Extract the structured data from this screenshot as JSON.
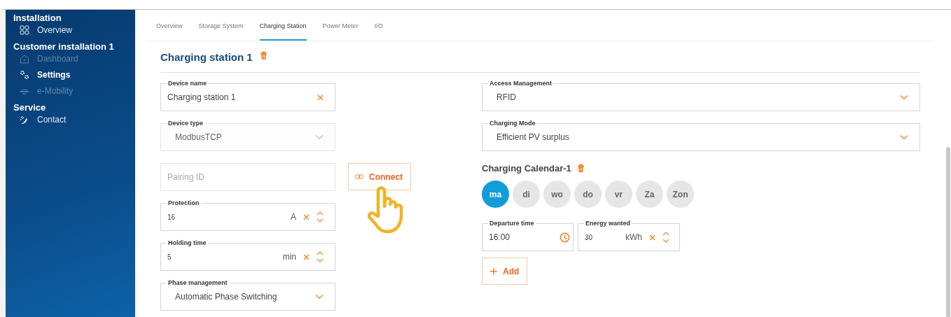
{
  "sidebar": {
    "sections": [
      {
        "title": "Installation",
        "items": [
          {
            "label": "Overview",
            "selected": false,
            "disabled": false
          }
        ]
      },
      {
        "title": "Customer installation 1",
        "items": [
          {
            "label": "Dashboard",
            "selected": false,
            "disabled": true
          },
          {
            "label": "Settings",
            "selected": true,
            "disabled": false
          },
          {
            "label": "e-Mobility",
            "selected": false,
            "disabled": true
          }
        ]
      },
      {
        "title": "Service",
        "items": [
          {
            "label": "Contact",
            "selected": false,
            "disabled": false
          }
        ]
      }
    ]
  },
  "tabs": [
    {
      "label": "Overview",
      "selected": false
    },
    {
      "label": "Storage System",
      "selected": false
    },
    {
      "label": "Charging Station",
      "selected": true
    },
    {
      "label": "Power Meter",
      "selected": false
    },
    {
      "label": "I/O",
      "selected": false
    }
  ],
  "device": {
    "title": "Charging station 1",
    "left_fields": [
      {
        "kind": "text",
        "label": "Device name",
        "value": "Charging station 1"
      },
      {
        "kind": "select",
        "label": "Device type",
        "value": "ModbusTCP",
        "disabled": true
      },
      {
        "kind": "placeholder",
        "placeholder": "Pairing ID"
      },
      {
        "kind": "number",
        "label": "Protection",
        "value": "16",
        "unit": "A"
      },
      {
        "kind": "number",
        "label": "Holding time",
        "value": "5",
        "unit": "min"
      },
      {
        "kind": "select",
        "label": "Phase management",
        "value": "Automatic Phase Switching",
        "disabled": false
      }
    ],
    "connect_button": "Connect",
    "right_fields": [
      {
        "kind": "select",
        "label": "Access Management",
        "value": "RFID",
        "disabled": false
      },
      {
        "kind": "select",
        "label": "Charging Mode",
        "value": "Efficient PV surplus",
        "disabled": false
      }
    ]
  },
  "calendar": {
    "title": "Charging Calendar-1",
    "days": [
      {
        "label": "ma",
        "selected": true
      },
      {
        "label": "di",
        "selected": false
      },
      {
        "label": "wo",
        "selected": false
      },
      {
        "label": "do",
        "selected": false
      },
      {
        "label": "vr",
        "selected": false
      },
      {
        "label": "Za",
        "selected": false
      },
      {
        "label": "Zon",
        "selected": false
      }
    ],
    "fields": [
      {
        "kind": "time",
        "label": "Departure time",
        "value": "16:00"
      },
      {
        "kind": "number",
        "label": "Energy wanted",
        "value": "30",
        "unit": "kWh"
      }
    ],
    "add_button": "Add"
  }
}
